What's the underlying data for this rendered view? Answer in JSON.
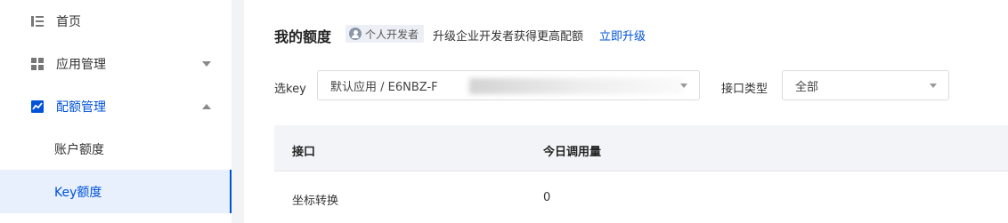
{
  "sidebar": {
    "items": [
      {
        "label": "首页",
        "icon": "list-icon"
      },
      {
        "label": "应用管理",
        "icon": "grid-icon",
        "expanded": false
      },
      {
        "label": "配额管理",
        "icon": "chart-icon",
        "expanded": true,
        "active": true
      }
    ],
    "sub_items": [
      {
        "label": "账户额度"
      },
      {
        "label": "Key额度",
        "selected": true
      }
    ]
  },
  "main": {
    "title": "我的额度",
    "badge": "个人开发者",
    "upgrade_text": "升级企业开发者获得更高配额",
    "upgrade_link": "立即升级",
    "key_filter": {
      "label": "选key",
      "value": "默认应用 / E6NBZ-F"
    },
    "type_filter": {
      "label": "接口类型",
      "value": "全部"
    },
    "table": {
      "headers": [
        "接口",
        "今日调用量"
      ],
      "rows": [
        [
          "坐标转换",
          "0"
        ]
      ]
    }
  },
  "colors": {
    "accent": "#0052d9",
    "sidebar_selected_bg": "#e8f0fd",
    "page_bg": "#f2f3f5"
  }
}
